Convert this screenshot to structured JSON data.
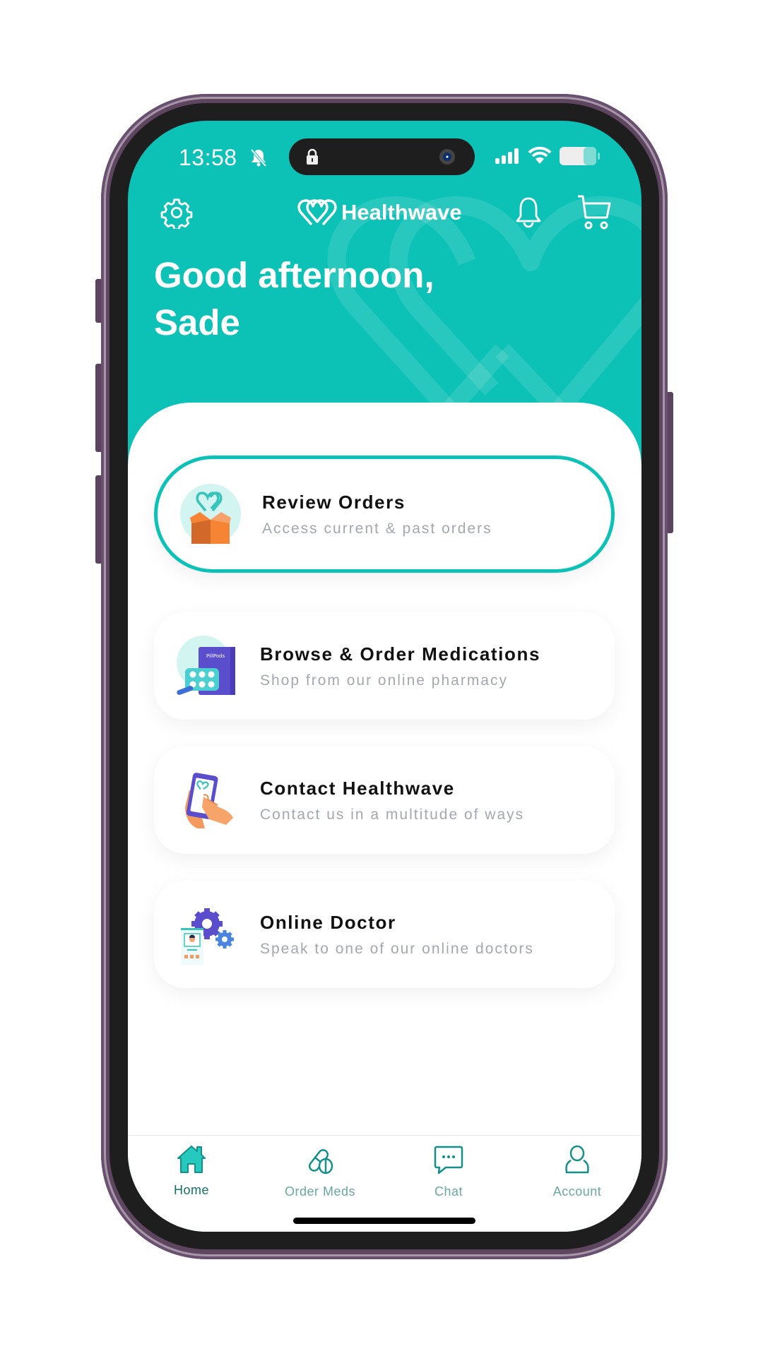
{
  "status_bar": {
    "time": "13:58",
    "icons": [
      "bell-slash-icon",
      "lock-icon",
      "signal-icon",
      "wifi-icon",
      "battery-icon"
    ]
  },
  "header": {
    "brand": "Healthwave",
    "left_icon": "gear-icon",
    "right_icons": [
      "bell-icon",
      "cart-icon"
    ]
  },
  "greeting": {
    "line1": "Good afternoon,",
    "line2": "Sade"
  },
  "menu": [
    {
      "title": "Review Orders",
      "subtitle": "Access current & past orders",
      "icon": "order-box-icon",
      "selected": true
    },
    {
      "title": "Browse & Order Medications",
      "subtitle": "Shop from our online pharmacy",
      "icon": "pill-pack-icon",
      "selected": false,
      "icon_text": "PillPods"
    },
    {
      "title": "Contact Healthwave",
      "subtitle": "Contact us in a multitude of ways",
      "icon": "phone-hand-icon",
      "selected": false
    },
    {
      "title": "Online Doctor",
      "subtitle": "Speak to one of our online doctors",
      "icon": "doctor-gears-icon",
      "selected": false
    }
  ],
  "bottom_nav": [
    {
      "label": "Home",
      "icon": "home-icon",
      "active": true
    },
    {
      "label": "Order Meds",
      "icon": "pills-icon",
      "active": false
    },
    {
      "label": "Chat",
      "icon": "chat-icon",
      "active": false
    },
    {
      "label": "Account",
      "icon": "account-icon",
      "active": false
    }
  ],
  "colors": {
    "brand_teal": "#0cc1b6",
    "nav_active": "#13706a",
    "nav_inactive": "#6aa7a0",
    "subtitle_gray": "#a3a8b0",
    "frame_purple": "#5e4560"
  }
}
